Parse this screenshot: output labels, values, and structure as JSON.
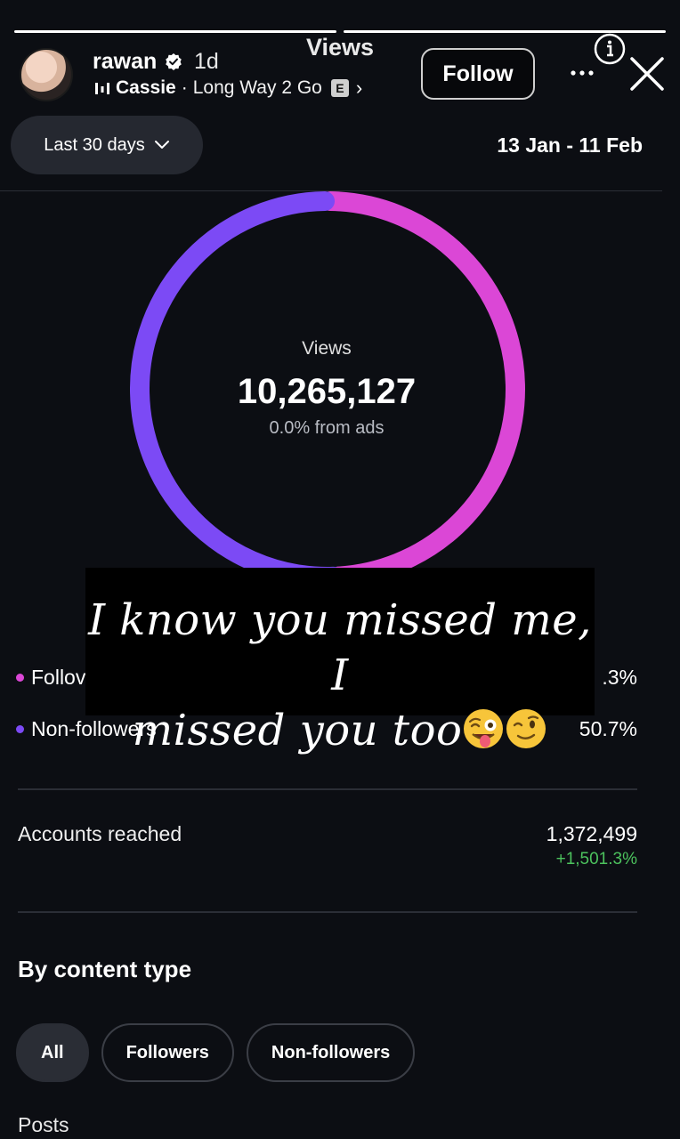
{
  "story": {
    "progress": [
      1.0,
      1.0
    ],
    "username": "rawan",
    "time_ago": "1d",
    "music_artist": "Cassie",
    "music_separator": " · ",
    "music_song": "Long Way 2 Go",
    "explicit_badge": "E",
    "follow_label": "Follow",
    "title": "Views",
    "sticker_line1": "I know you missed me, I",
    "sticker_line2": "missed you too"
  },
  "filters": {
    "range_label": "Last 30 days",
    "date_range": "13 Jan - 11 Feb"
  },
  "summary": {
    "label": "Views",
    "total": "10,265,127",
    "ads_note": "0.0% from ads"
  },
  "chart_data": {
    "type": "pie",
    "categories": [
      "Followers",
      "Non-followers"
    ],
    "values": [
      49.3,
      50.7
    ],
    "colors": [
      "#db47d6",
      "#7c4af5"
    ]
  },
  "breakdown": {
    "followers_label": "Follov",
    "followers_pct": ".3%",
    "nonfollowers_label": "Non-followers",
    "nonfollowers_pct": "50.7%",
    "followers_color": "#db47d6",
    "nonfollowers_color": "#7c4af5"
  },
  "reach": {
    "label": "Accounts reached",
    "value": "1,372,499",
    "change": "+1,501.3%"
  },
  "content_type": {
    "title": "By content type",
    "chips": [
      "All",
      "Followers",
      "Non-followers"
    ],
    "active": "All",
    "next_label": "Posts"
  },
  "icons": {
    "verified": "verified-badge-icon",
    "music": "music-bars-icon",
    "info": "info-icon",
    "more": "more-icon",
    "close": "close-icon",
    "chevron": "chevron-down-icon"
  }
}
